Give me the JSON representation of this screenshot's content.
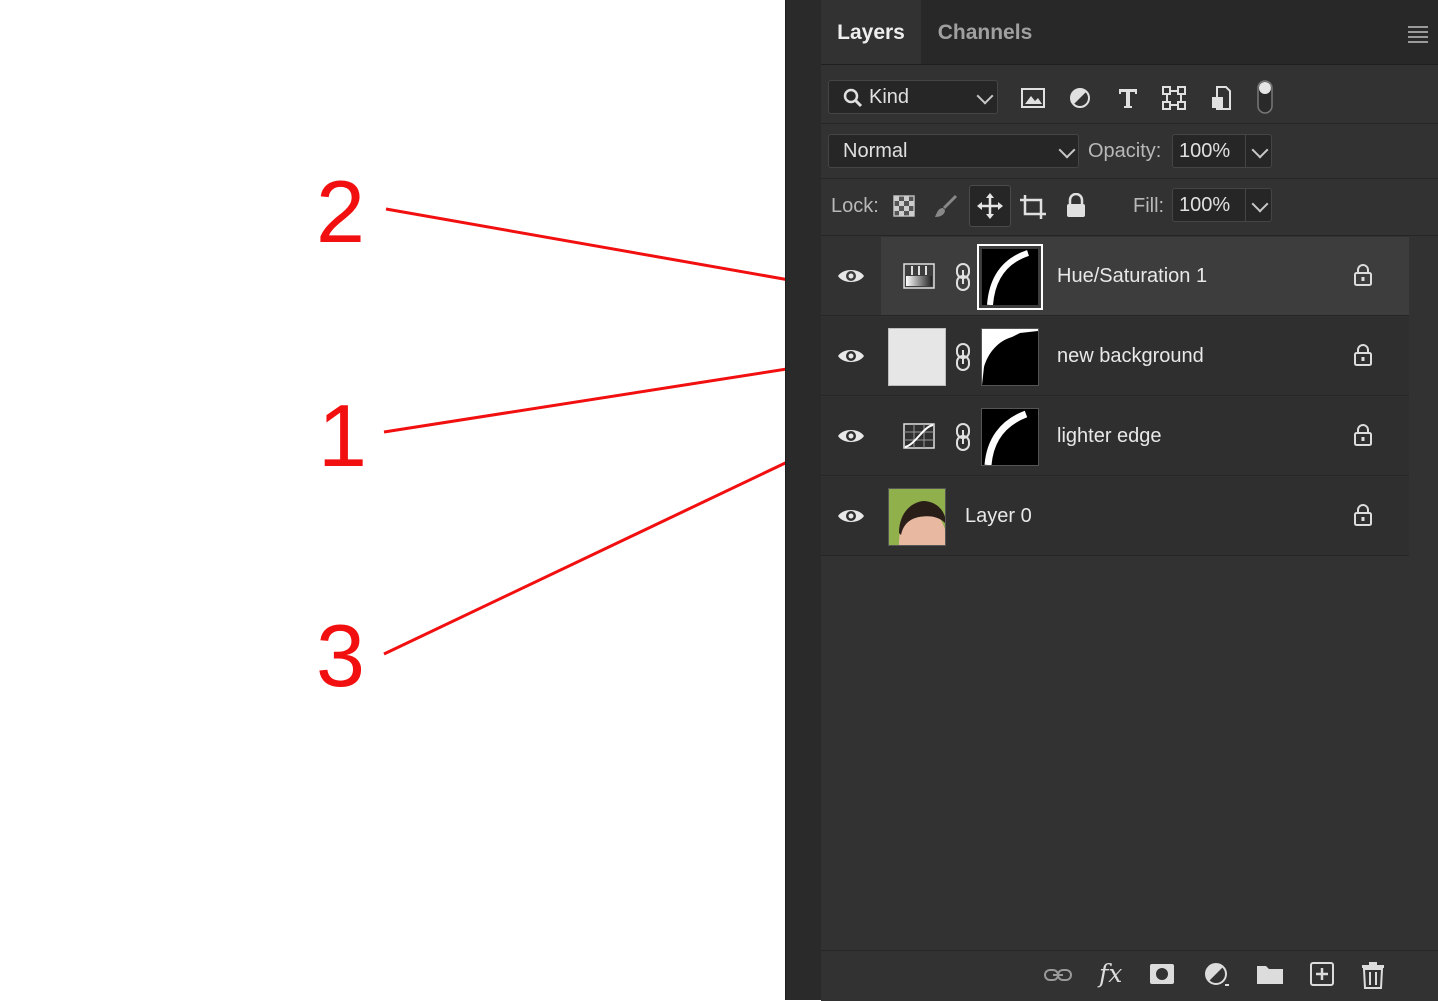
{
  "annotations": {
    "numbers": [
      "2",
      "1",
      "3"
    ],
    "line_color": "#f20f0f"
  },
  "panel": {
    "tabs": [
      "Layers",
      "Channels"
    ],
    "active_tab": "Layers",
    "filter": {
      "kind_label": "Kind",
      "icons": [
        "image-filter-icon",
        "adjustment-filter-icon",
        "type-filter-icon",
        "shape-filter-icon",
        "smart-object-filter-icon",
        "filter-toggle-icon"
      ]
    },
    "blend_mode": "Normal",
    "opacity_label": "Opacity:",
    "opacity_value": "100%",
    "lock_label": "Lock:",
    "lock_icons": [
      "lock-transparent-pixels-icon",
      "lock-image-pixels-icon",
      "lock-position-icon",
      "lock-artboard-icon",
      "lock-all-icon"
    ],
    "fill_label": "Fill:",
    "fill_value": "100%",
    "layers": [
      {
        "name": "Hue/Saturation 1",
        "type": "hue-saturation-adjustment",
        "selected": true
      },
      {
        "name": "new background",
        "type": "solid-fill",
        "selected": false
      },
      {
        "name": "lighter edge",
        "type": "curves-adjustment",
        "selected": false
      },
      {
        "name": "Layer 0",
        "type": "pixel-layer",
        "selected": false
      }
    ],
    "bottom_icons": [
      "link-layers-icon",
      "fx-icon",
      "add-mask-icon",
      "new-adjustment-icon",
      "new-group-icon",
      "new-layer-icon",
      "delete-layer-icon"
    ]
  }
}
